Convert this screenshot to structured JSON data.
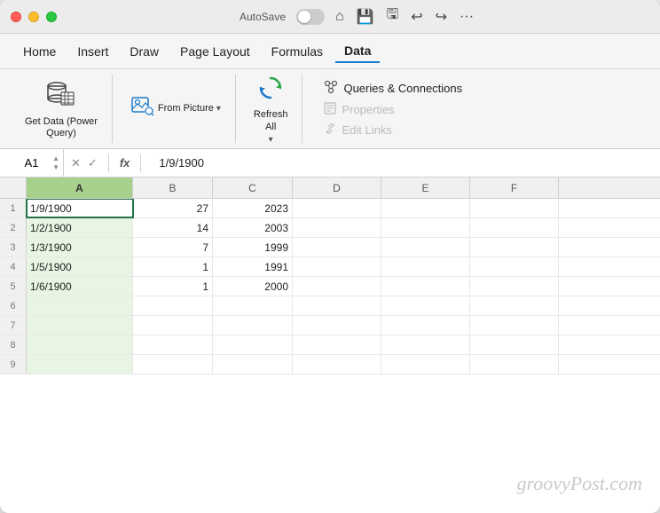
{
  "titlebar": {
    "autosave_label": "AutoSave",
    "toggle_state": "off"
  },
  "menubar": {
    "items": [
      "Home",
      "Insert",
      "Draw",
      "Page Layout",
      "Formulas",
      "Data"
    ],
    "active_index": 5
  },
  "ribbon": {
    "get_data_label": "Get Data (Power\nQuery)",
    "from_picture_label": "From Picture",
    "refresh_all_label": "Refresh\nAll",
    "queries_connections_label": "Queries & Connections",
    "properties_label": "Properties",
    "edit_links_label": "Edit Links"
  },
  "formula_bar": {
    "cell_ref": "A1",
    "formula_value": "1/9/1900"
  },
  "spreadsheet": {
    "col_headers": [
      "A",
      "B",
      "C",
      "D",
      "E",
      "F"
    ],
    "rows": [
      {
        "row": 1,
        "a": "1/9/1900",
        "b": "27",
        "c": "2023",
        "d": "",
        "e": "",
        "f": ""
      },
      {
        "row": 2,
        "a": "1/2/1900",
        "b": "14",
        "c": "2003",
        "d": "",
        "e": "",
        "f": ""
      },
      {
        "row": 3,
        "a": "1/3/1900",
        "b": "7",
        "c": "1999",
        "d": "",
        "e": "",
        "f": ""
      },
      {
        "row": 4,
        "a": "1/5/1900",
        "b": "1",
        "c": "1991",
        "d": "",
        "e": "",
        "f": ""
      },
      {
        "row": 5,
        "a": "1/6/1900",
        "b": "1",
        "c": "2000",
        "d": "",
        "e": "",
        "f": ""
      },
      {
        "row": 6,
        "a": "",
        "b": "",
        "c": "",
        "d": "",
        "e": "",
        "f": ""
      },
      {
        "row": 7,
        "a": "",
        "b": "",
        "c": "",
        "d": "",
        "e": "",
        "f": ""
      },
      {
        "row": 8,
        "a": "",
        "b": "",
        "c": "",
        "d": "",
        "e": "",
        "f": ""
      },
      {
        "row": 9,
        "a": "",
        "b": "",
        "c": "",
        "d": "",
        "e": "",
        "f": ""
      }
    ]
  },
  "watermark": {
    "text": "groovyPost.com"
  },
  "colors": {
    "active_tab_underline": "#1a7acc",
    "selected_col_bg": "#e8f5e2",
    "selected_col_header_bg": "#a8d08d",
    "active_cell_border": "#217346"
  }
}
